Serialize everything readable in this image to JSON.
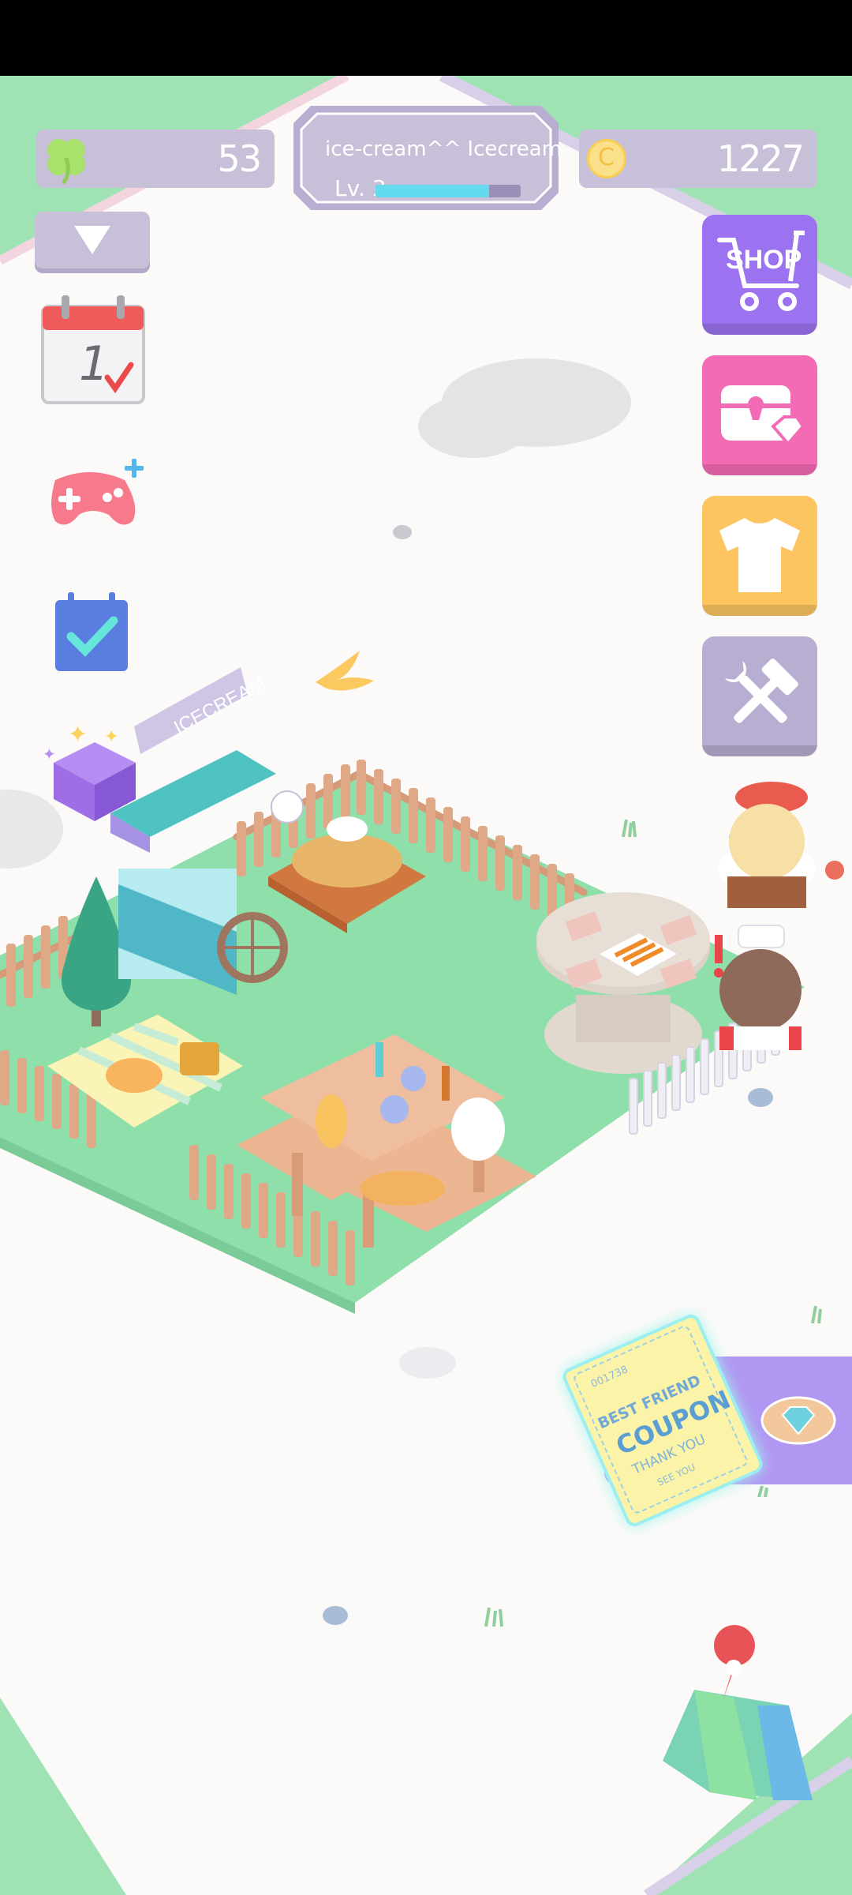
{
  "hud": {
    "clovers": "53",
    "coins": "1227",
    "coin_symbol": "C",
    "profile_name": "ice-cream^^ Icecream",
    "level": "Lv. 3",
    "xp_fraction": 0.78
  },
  "scene": {
    "cart_sign": "ICECREAM",
    "calendar_day": "1"
  },
  "buttons": {
    "shop_label": "SHOP"
  },
  "coupon": {
    "serial": "001738",
    "line1": "BEST FRIEND",
    "line2": "COUPON",
    "line3": "THANK YOU",
    "footer": "SEE YOU"
  },
  "colors": {
    "grass": "#8fdfaa",
    "hud_pill": "#c8c0d8",
    "shop": "#9b73f0",
    "chest": "#f46bb5",
    "clothing": "#fcc55f",
    "tools": "#b8aed2",
    "xp_fill": "#63dbef",
    "coupon_panel": "#b097f2"
  }
}
